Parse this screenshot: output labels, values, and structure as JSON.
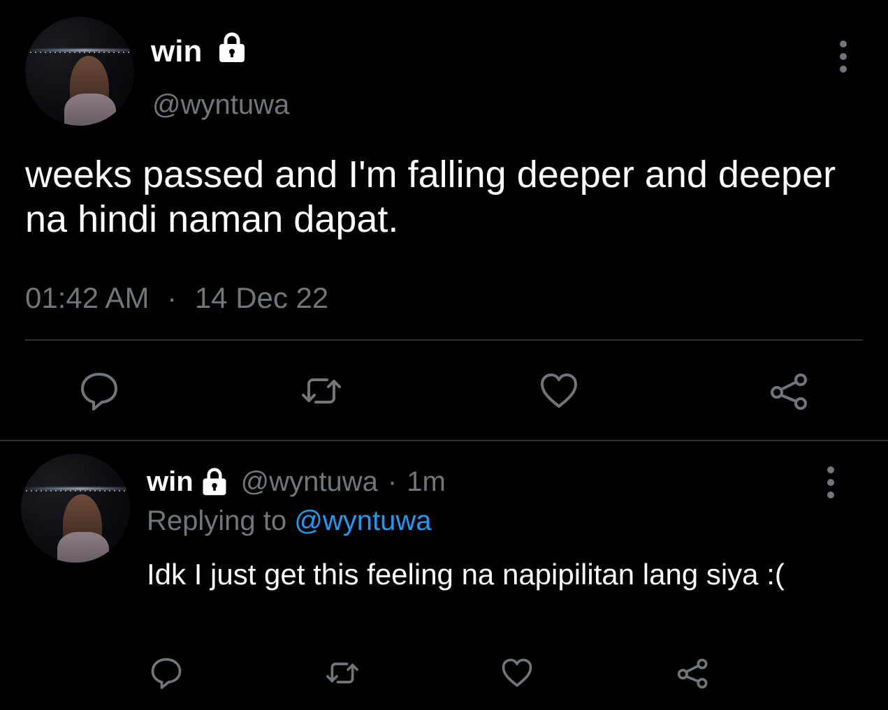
{
  "main_tweet": {
    "author": {
      "name": "win",
      "handle": "@wyntuwa",
      "avatar": "avatar",
      "protected_icon": "lock-icon"
    },
    "text": "weeks passed and I'm falling deeper and deeper na hindi naman dapat.",
    "time": "01:42 AM",
    "separator": "·",
    "date": "14 Dec 22",
    "actions": [
      {
        "name": "reply",
        "icon": "comment-icon"
      },
      {
        "name": "retweet",
        "icon": "retweet-icon"
      },
      {
        "name": "like",
        "icon": "heart-icon"
      },
      {
        "name": "share",
        "icon": "share-icon"
      }
    ],
    "more_icon": "more-vertical-icon"
  },
  "reply_tweet": {
    "author": {
      "name": "win",
      "handle": "@wyntuwa",
      "protected_icon": "lock-icon"
    },
    "separator": "·",
    "age": "1m",
    "replying_prefix": "Replying to",
    "replying_to": "@wyntuwa",
    "text": "Idk I just get this feeling na napipilitan lang siya :(",
    "actions": [
      {
        "name": "reply",
        "icon": "comment-icon"
      },
      {
        "name": "retweet",
        "icon": "retweet-icon"
      },
      {
        "name": "like",
        "icon": "heart-icon"
      },
      {
        "name": "share",
        "icon": "share-icon"
      }
    ],
    "more_icon": "more-vertical-icon"
  },
  "colors": {
    "background": "#000000",
    "text_primary": "#ffffff",
    "text_secondary": "#71767b",
    "accent": "#1d9bf0",
    "divider": "#2f3336"
  }
}
